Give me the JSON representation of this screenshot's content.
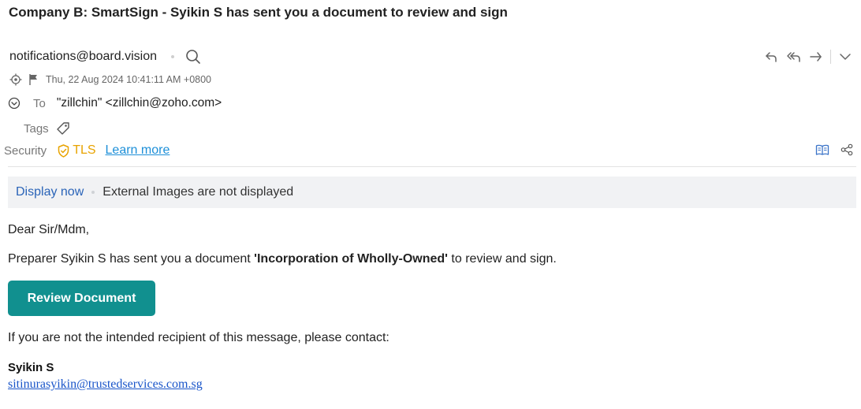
{
  "email": {
    "subject": "Company B: SmartSign - Syikin S has sent you a document to review and sign",
    "sender": "notifications@board.vision",
    "date": "Thu, 22 Aug 2024 10:41:11 AM +0800",
    "to_label": "To",
    "to_value": "\"zillchin\" <zillchin@zoho.com>",
    "tags_label": "Tags",
    "security_label": "Security",
    "security_value": "TLS",
    "learn_more": "Learn more"
  },
  "banner": {
    "action": "Display now",
    "info": "External Images are not displayed"
  },
  "body": {
    "greeting": "Dear Sir/Mdm,",
    "para_prefix": "Preparer Syikin S has sent you a document ",
    "doc_name": "'Incorporation of Wholly-Owned'",
    "para_suffix": " to review and sign.",
    "button_label": "Review Document",
    "contact_line": "If you are not the intended recipient of this message, please contact:",
    "signature_name": "Syikin S",
    "signature_email": "sitinurasyikin@trustedservices.com.sg"
  },
  "colors": {
    "accent_button": "#11908f",
    "link": "#1a55c9",
    "tls": "#e8a300"
  },
  "icons": [
    "search-icon",
    "reply-icon",
    "reply-all-icon",
    "forward-icon",
    "more-chevron-icon",
    "target-icon",
    "flag-icon",
    "expand-icon",
    "tag-icon",
    "shield-icon",
    "book-icon",
    "share-icon"
  ]
}
